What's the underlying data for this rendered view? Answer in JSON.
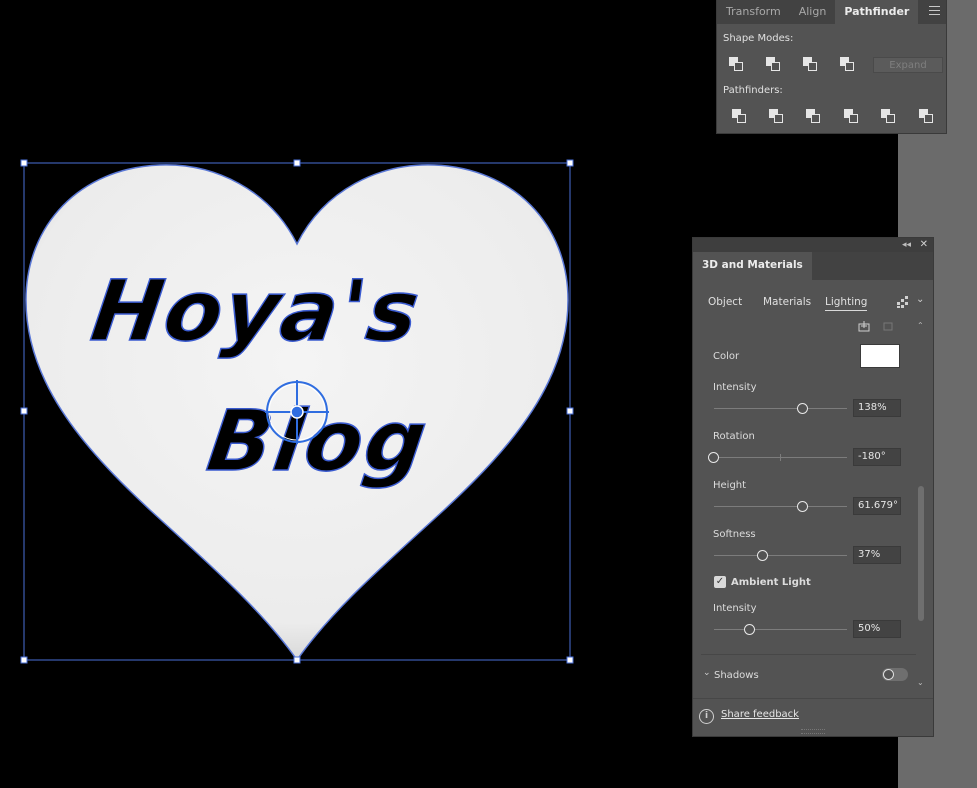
{
  "pathfinder_panel": {
    "tabs": [
      "Transform",
      "Align",
      "Pathfinder"
    ],
    "active_tab": "Pathfinder",
    "shape_modes_label": "Shape Modes:",
    "pathfinders_label": "Pathfinders:",
    "expand_label": "Expand"
  },
  "artwork": {
    "line1": "Hoya's",
    "line2": "Blog"
  },
  "panel_3d": {
    "title": "3D and Materials",
    "sub_tabs": [
      "Object",
      "Materials",
      "Lighting"
    ],
    "active_sub_tab": "Lighting",
    "color_label": "Color",
    "color_value": "#ffffff",
    "intensity_label": "Intensity",
    "intensity_value": "138%",
    "intensity_level": 0.67,
    "rotation_label": "Rotation",
    "rotation_value": "-180°",
    "rotation_level": 0.0,
    "height_label": "Height",
    "height_value": "61.679°",
    "height_level": 0.67,
    "softness_label": "Softness",
    "softness_value": "37%",
    "softness_level": 0.37,
    "ambient_light_label": "Ambient Light",
    "ambient_checked": true,
    "ambient_intensity_label": "Intensity",
    "ambient_intensity_value": "50%",
    "ambient_intensity_level": 0.27,
    "shadows_label": "Shadows",
    "shadows_on": false,
    "feedback_label": "Share feedback"
  },
  "colors": {
    "panel_bg": "#535353",
    "selection_blue": "#4a6fd8",
    "art_white": "#efefef"
  }
}
